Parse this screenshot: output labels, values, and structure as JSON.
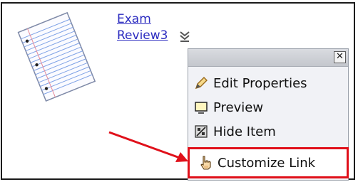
{
  "item": {
    "title_line1": "Exam",
    "title_line2": "Review3"
  },
  "menu": {
    "close_glyph": "✕",
    "items": [
      {
        "label": "Edit Properties",
        "icon": "pencil-icon"
      },
      {
        "label": "Preview",
        "icon": "preview-window-icon"
      },
      {
        "label": "Hide Item",
        "icon": "hide-item-icon"
      },
      {
        "label": "Customize Link",
        "icon": "hand-pointer-icon"
      }
    ]
  },
  "colors": {
    "link": "#2c2cc0",
    "highlight": "#e0101a",
    "menu_bg": "#f1f2f6"
  }
}
